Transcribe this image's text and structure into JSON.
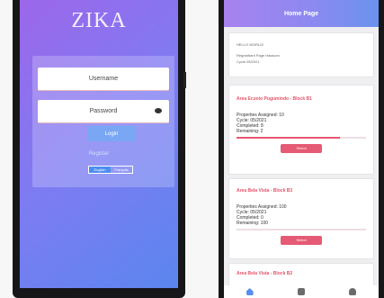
{
  "login": {
    "logo": "ZIKA",
    "username_placeholder": "Username",
    "password_placeholder": "Password",
    "login_button": "Login",
    "register_link": "Register",
    "lang_options": [
      "English",
      "Français"
    ]
  },
  "home": {
    "title": "Home Page",
    "info_card": {
      "greeting": "HELLO WORLD!",
      "subtitle": "Regrantiant Page Hawsom",
      "cycle": "Cycle 05/2021"
    },
    "zones": [
      {
        "title": "Area Ecuoio Pugumindo - Block B1",
        "assigned": "Properties Assigned: 10",
        "cycle": "Cycle: 05/2021",
        "completed": "Completed: 8",
        "remaining": "Remaining: 2",
        "progress": 0.8,
        "action": "Select"
      },
      {
        "title": "Area Bela Vista - Block B3",
        "assigned": "Properties Assigned: 100",
        "cycle": "Cycle: 05/2021",
        "completed": "Completed: 0",
        "remaining": "Remaining: 100",
        "progress": 0.0,
        "action": "Select"
      },
      {
        "title": "Area Bela Vista - Block B2"
      }
    ],
    "nav_icons": [
      "home-icon",
      "document-icon",
      "user-icon"
    ]
  },
  "colors": {
    "login_gradient_start": "#9c67ea",
    "login_gradient_end": "#5b86ee",
    "accent_red": "#e55a74",
    "accent_blue": "#5a8df1"
  }
}
